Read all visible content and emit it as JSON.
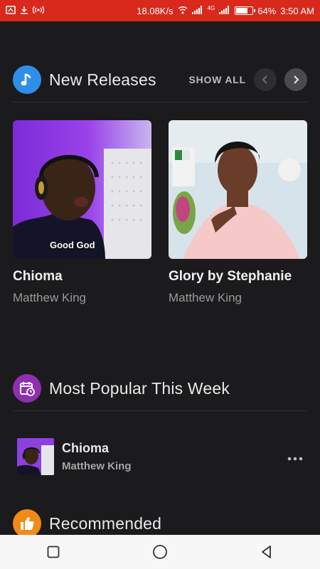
{
  "status_bar": {
    "speed": "18.08K/s",
    "network": "4G",
    "battery": "64%",
    "battery_level": 0.64,
    "time": "3:50 AM"
  },
  "new_releases": {
    "title": "New Releases",
    "show_all": "SHOW ALL",
    "items": [
      {
        "title": "Chioma",
        "artist": "Matthew King",
        "art_caption": "Good God"
      },
      {
        "title": "Glory by Stephanie",
        "artist": "Matthew King"
      }
    ]
  },
  "most_popular": {
    "title": "Most Popular This Week",
    "items": [
      {
        "title": "Chioma",
        "artist": "Matthew King"
      }
    ]
  },
  "recommended": {
    "title": "Recommended"
  },
  "colors": {
    "status_bar": "#d8291c",
    "background": "#1b1b1d",
    "new_releases_icon": "#2f8fe8",
    "most_popular_icon": "#8e2fb0",
    "recommended_icon": "#f08b18"
  },
  "icons": {
    "new_releases": "music-note-icon",
    "most_popular": "calendar-clock-icon",
    "recommended": "thumbs-up-icon"
  }
}
